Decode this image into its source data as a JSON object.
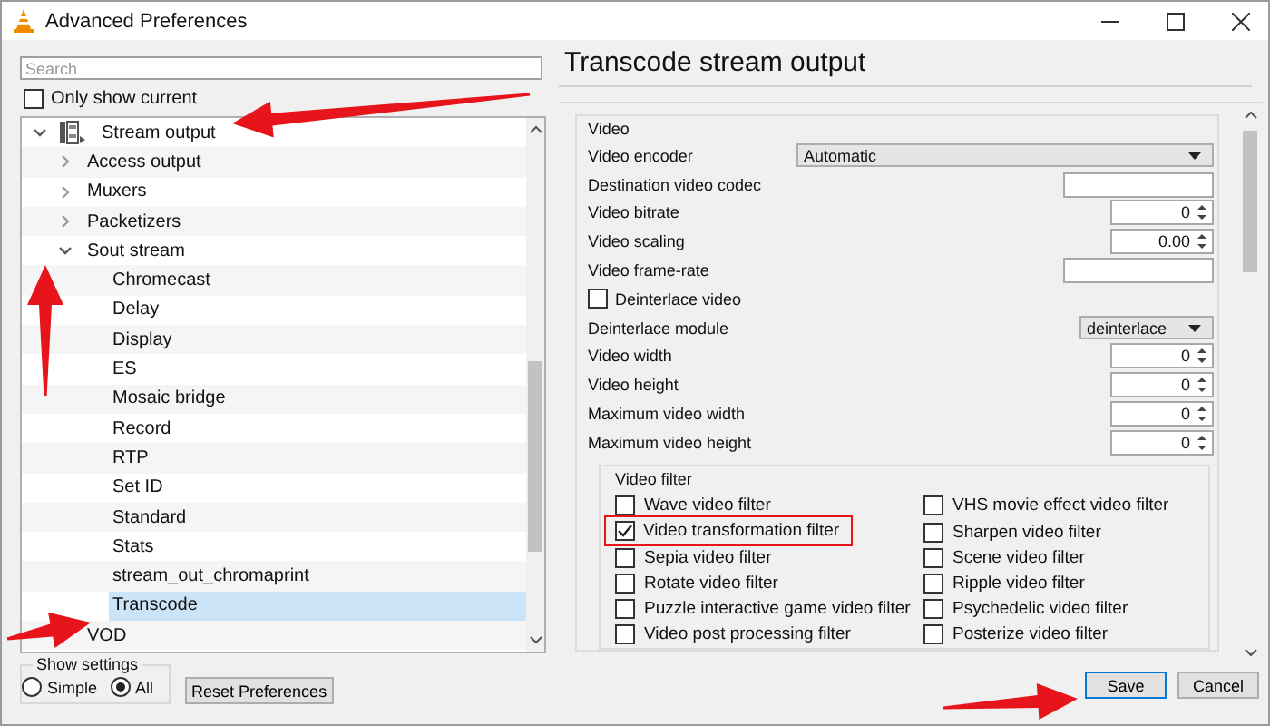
{
  "window": {
    "title": "Advanced Preferences"
  },
  "search": {
    "placeholder": "Search"
  },
  "only_show_current": {
    "label": "Only show current",
    "checked": false
  },
  "tree": [
    {
      "label": "Stream output",
      "expanded": true,
      "selected": false,
      "children": [
        {
          "label": "Access output",
          "expanded": false,
          "selected": false
        },
        {
          "label": "Muxers",
          "expanded": false,
          "selected": false
        },
        {
          "label": "Packetizers",
          "expanded": false,
          "selected": false
        },
        {
          "label": "Sout stream",
          "expanded": true,
          "selected": false,
          "children": [
            {
              "label": "Chromecast",
              "selected": false
            },
            {
              "label": "Delay",
              "selected": false
            },
            {
              "label": "Display",
              "selected": false
            },
            {
              "label": "ES",
              "selected": false
            },
            {
              "label": "Mosaic bridge",
              "selected": false
            },
            {
              "label": "Record",
              "selected": false
            },
            {
              "label": "RTP",
              "selected": false
            },
            {
              "label": "Set ID",
              "selected": false
            },
            {
              "label": "Standard",
              "selected": false
            },
            {
              "label": "Stats",
              "selected": false
            },
            {
              "label": "stream_out_chromaprint",
              "selected": false
            },
            {
              "label": "Transcode",
              "selected": true
            }
          ]
        },
        {
          "label": "VOD",
          "expanded": false,
          "selected": false
        }
      ]
    }
  ],
  "show_settings": {
    "title": "Show settings",
    "options": [
      {
        "label": "Simple",
        "selected": false
      },
      {
        "label": "All",
        "selected": true
      }
    ]
  },
  "reset_button": "Reset Preferences",
  "panel_title": "Transcode stream output",
  "video_group": {
    "title": "Video",
    "rows": [
      {
        "kind": "select",
        "label": "Video encoder",
        "value": "Automatic",
        "wide": true
      },
      {
        "kind": "text",
        "label": "Destination video codec"
      },
      {
        "kind": "spin",
        "label": "Video bitrate",
        "value": "0"
      },
      {
        "kind": "spin",
        "label": "Video scaling",
        "value": "0.00"
      },
      {
        "kind": "text",
        "label": "Video frame-rate"
      },
      {
        "kind": "checkbox",
        "label": "Deinterlace video",
        "checked": false
      },
      {
        "kind": "select",
        "label": "Deinterlace module",
        "value": "deinterlace",
        "wide": false
      },
      {
        "kind": "spin",
        "label": "Video width",
        "value": "0"
      },
      {
        "kind": "spin",
        "label": "Video height",
        "value": "0"
      },
      {
        "kind": "spin",
        "label": "Maximum video width",
        "value": "0"
      },
      {
        "kind": "spin",
        "label": "Maximum video height",
        "value": "0"
      }
    ]
  },
  "filter_group": {
    "title": "Video filter",
    "filters": [
      {
        "label": "Wave video filter",
        "checked": false
      },
      {
        "label": "VHS movie effect video filter",
        "checked": false
      },
      {
        "label": "Video transformation filter",
        "checked": true
      },
      {
        "label": "Sharpen video filter",
        "checked": false
      },
      {
        "label": "Sepia video filter",
        "checked": false
      },
      {
        "label": "Scene video filter",
        "checked": false
      },
      {
        "label": "Rotate video filter",
        "checked": false
      },
      {
        "label": "Ripple video filter",
        "checked": false
      },
      {
        "label": "Puzzle interactive game video filter",
        "checked": false
      },
      {
        "label": "Psychedelic video filter",
        "checked": false
      },
      {
        "label": "Video post processing filter",
        "checked": false
      },
      {
        "label": "Posterize video filter",
        "checked": false
      }
    ]
  },
  "buttons": [
    {
      "label": "Save",
      "focused": true
    },
    {
      "label": "Cancel",
      "focused": false
    }
  ]
}
